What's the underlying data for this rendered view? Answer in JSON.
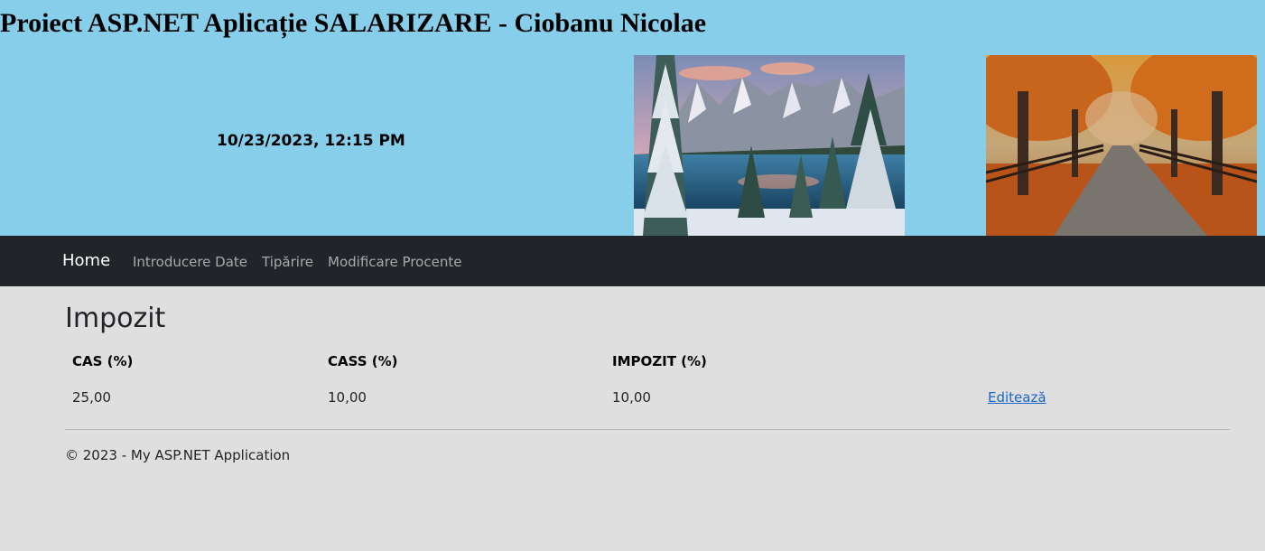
{
  "header": {
    "title": "Proiect ASP.NET Aplicație SALARIZARE - Ciobanu Nicolae",
    "datetime": "10/23/2023, 12:15 PM"
  },
  "navbar": {
    "brand": "Home",
    "links": [
      "Introducere Date",
      "Tipărire",
      "Modificare Procente"
    ]
  },
  "main": {
    "title": "Impozit",
    "table": {
      "headers": [
        "CAS (%)",
        "CASS (%)",
        "IMPOZIT (%)"
      ],
      "rows": [
        {
          "cas": "25,00",
          "cass": "10,00",
          "impozit": "10,00",
          "action": "Editează"
        }
      ]
    }
  },
  "footer": {
    "text": "© 2023 - My ASP.NET Application"
  },
  "colors": {
    "banner": "#87ceeb",
    "navbar": "#212529",
    "page": "#dfdfdf",
    "link": "#1a66c7"
  }
}
